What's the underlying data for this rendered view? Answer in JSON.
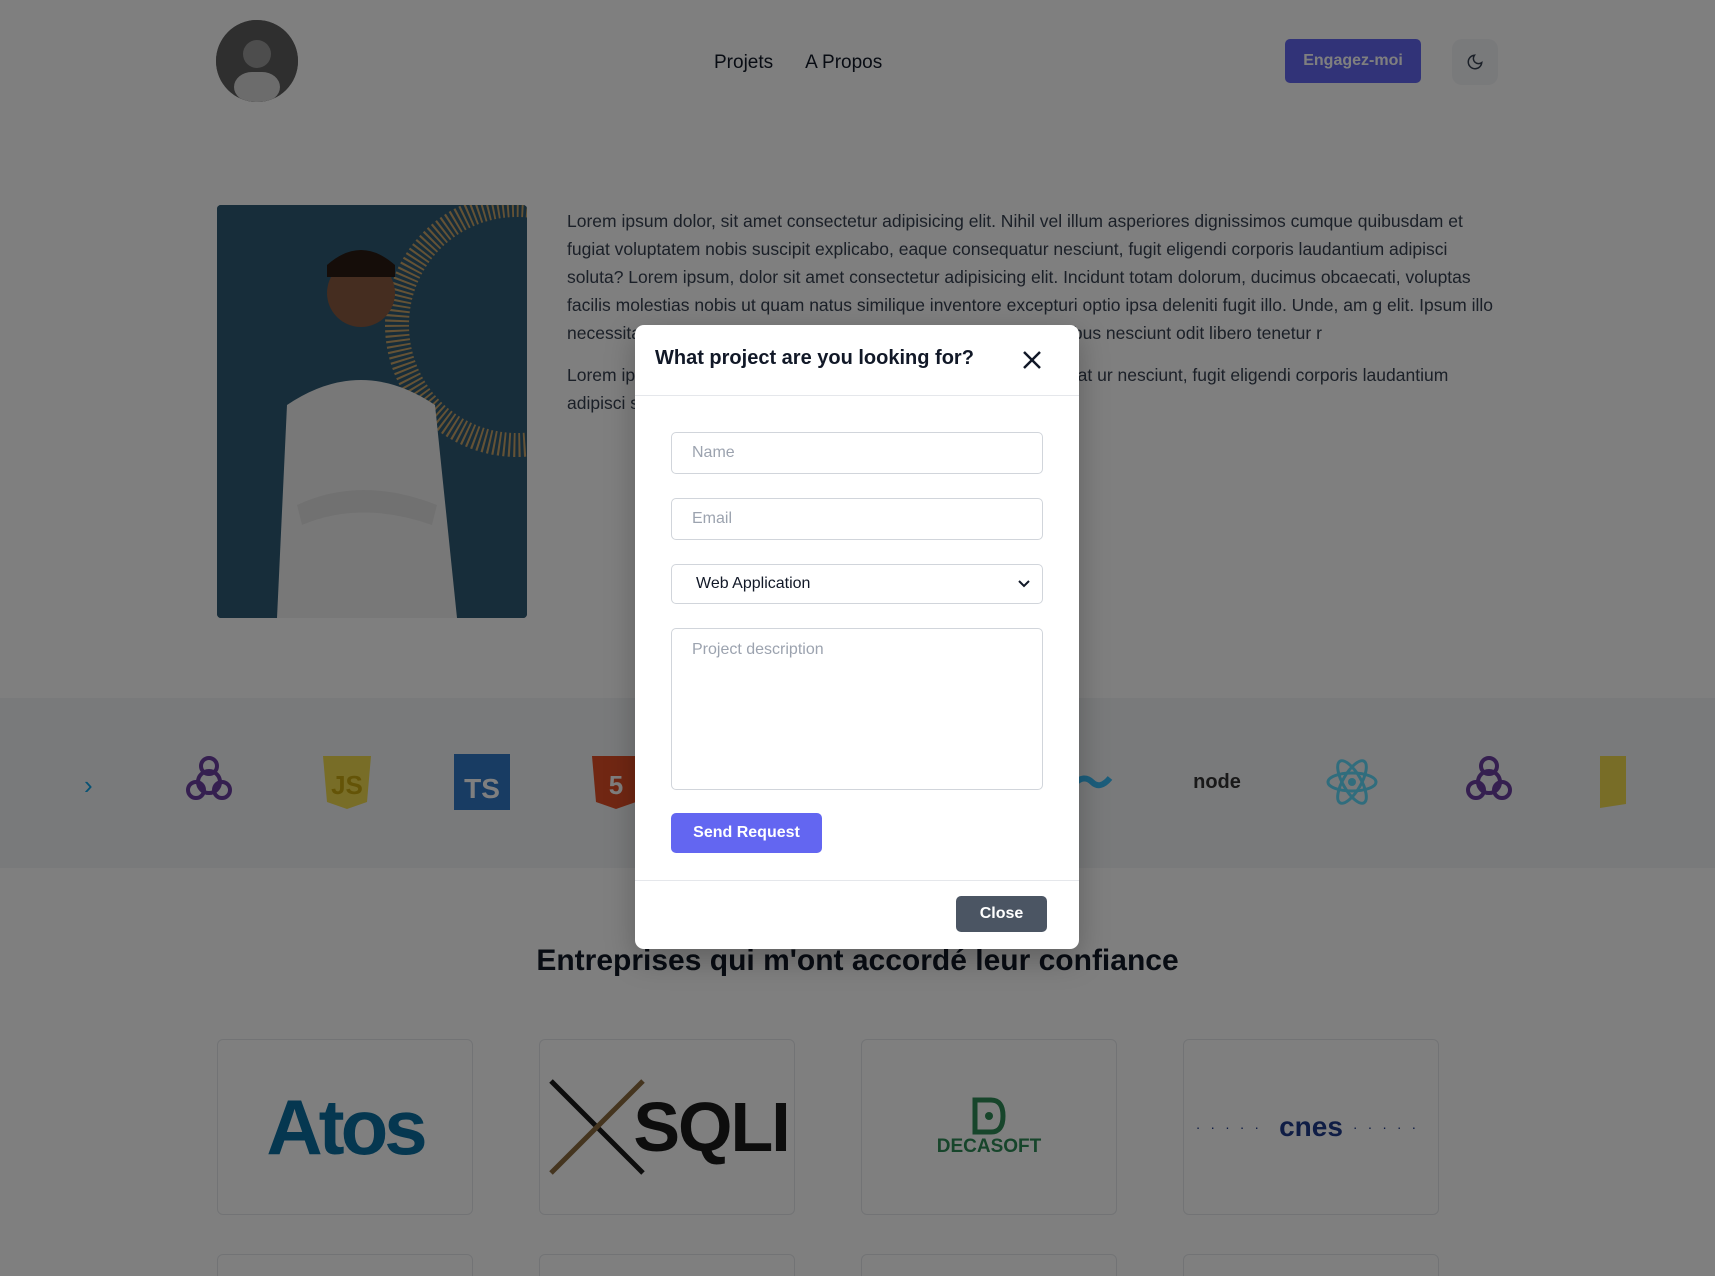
{
  "header": {
    "nav_items": [
      "Projets",
      "A Propos"
    ],
    "hire_label": "Engagez-moi"
  },
  "about": {
    "paragraph_1": "Lorem ipsum dolor, sit amet consectetur adipisicing elit. Nihil vel illum asperiores dignissimos cumque quibusdam et fugiat voluptatem nobis suscipit explicabo, eaque consequatur nesciunt, fugit eligendi corporis laudantium adipisci soluta? Lorem ipsum, dolor sit amet consectetur adipisicing elit. Incidunt totam dolorum, ducimus obcaecati, voluptas facilis molestias nobis ut quam natus similique inventore excepturi optio ipsa deleniti fugit illo. Unde, am                                                  g elit. Ipsum illo necessitatibus perspiciatis! Aperiam                                                   usandae quas, fuga voluptatibus nesciunt odit libero tenetur r",
    "paragraph_2": "Lorem ip                                                  l illum asperiores dignissimos cumque quibusdam et fugiat                                                   ur nesciunt, fugit eligendi corporis laudantium adipisci s"
  },
  "tech_logos": [
    "graphql-icon",
    "javascript-icon",
    "typescript-icon",
    "html5-icon",
    "tailwind-icon",
    "nodejs-icon",
    "react-icon",
    "graphql-icon",
    "javascript-icon"
  ],
  "companies": {
    "title": "Entreprises qui m'ont accordé leur confiance",
    "logos": [
      "Atos",
      "SQLI",
      "DECASOFT",
      "cnes"
    ]
  },
  "modal": {
    "title": "What project are you looking for?",
    "name_placeholder": "Name",
    "email_placeholder": "Email",
    "project_type": "Web Application",
    "description_placeholder": "Project description",
    "send_label": "Send Request",
    "close_label": "Close"
  },
  "colors": {
    "accent": "#6366f1",
    "close_button": "#4b5563",
    "overlay": "rgba(0,0,0,0.5)"
  }
}
